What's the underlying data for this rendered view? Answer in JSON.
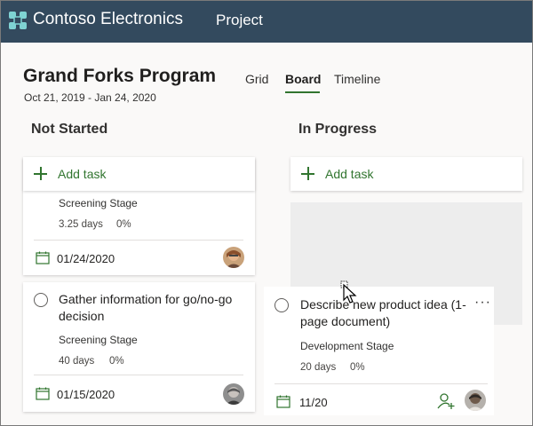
{
  "app": {
    "brand": "Contoso Electronics",
    "nav_label": "Project"
  },
  "plan": {
    "title": "Grand Forks Program",
    "dates": "Oct 21, 2019 - Jan 24, 2020"
  },
  "tabs": [
    {
      "label": "Grid"
    },
    {
      "label": "Board"
    },
    {
      "label": "Timeline"
    }
  ],
  "active_tab": "Board",
  "columns": [
    {
      "title": "Not Started",
      "add_task_label": "Add task",
      "cards": [
        {
          "name": "",
          "stage": "Screening Stage",
          "duration": "3.25 days",
          "percent": "0%",
          "due": "01/24/2020"
        },
        {
          "name": "Gather information for go/no-go decision",
          "stage": "Screening Stage",
          "duration": "40 days",
          "percent": "0%",
          "due": "01/15/2020"
        }
      ]
    },
    {
      "title": "In Progress",
      "add_task_label": "Add task",
      "cards": [
        {
          "name": "Describe new product idea (1-page document)",
          "stage": "Development Stage",
          "duration": "20 days",
          "percent": "0%",
          "due": "11/20"
        }
      ]
    }
  ],
  "icons": {
    "logo": "contoso-logo-icon",
    "add": "plus-icon",
    "calendar": "calendar-icon",
    "assign": "assign-person-icon",
    "more": "more-options-icon",
    "cursor": "move-cursor-icon"
  },
  "colors": {
    "header": "#334a5e",
    "accent": "#31752f",
    "ghost": "#ededed"
  }
}
